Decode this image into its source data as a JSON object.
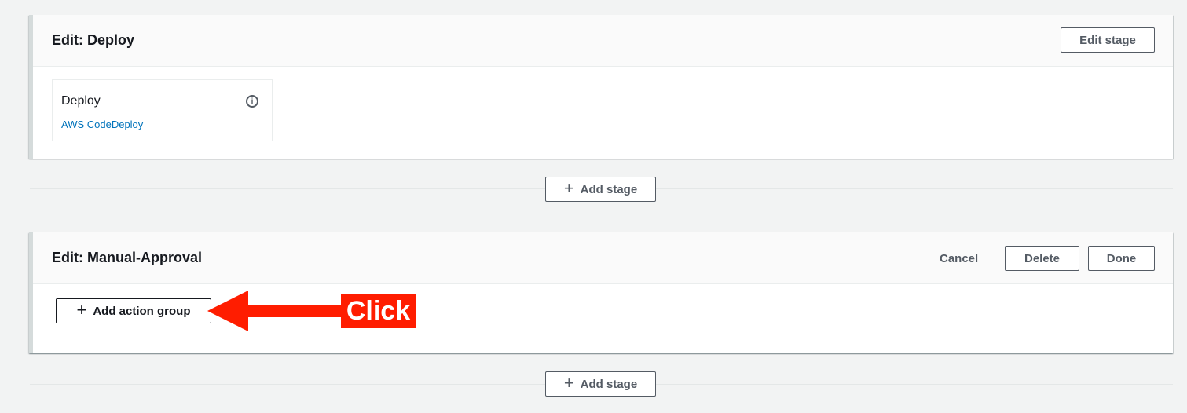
{
  "deploy_stage": {
    "title": "Edit: Deploy",
    "edit_button": "Edit stage",
    "action": {
      "name": "Deploy",
      "provider": "AWS CodeDeploy",
      "info_icon": "info-circle-icon"
    }
  },
  "add_stage_1": {
    "label": "Add stage",
    "icon": "plus-icon"
  },
  "approval_stage": {
    "title": "Edit: Manual-Approval",
    "cancel_label": "Cancel",
    "delete_label": "Delete",
    "done_label": "Done",
    "add_action_group_label": "Add action group",
    "add_action_group_icon": "plus-icon"
  },
  "add_stage_2": {
    "label": "Add stage",
    "icon": "plus-icon"
  },
  "annotation": {
    "label": "Click",
    "color": "#ff1d00"
  }
}
